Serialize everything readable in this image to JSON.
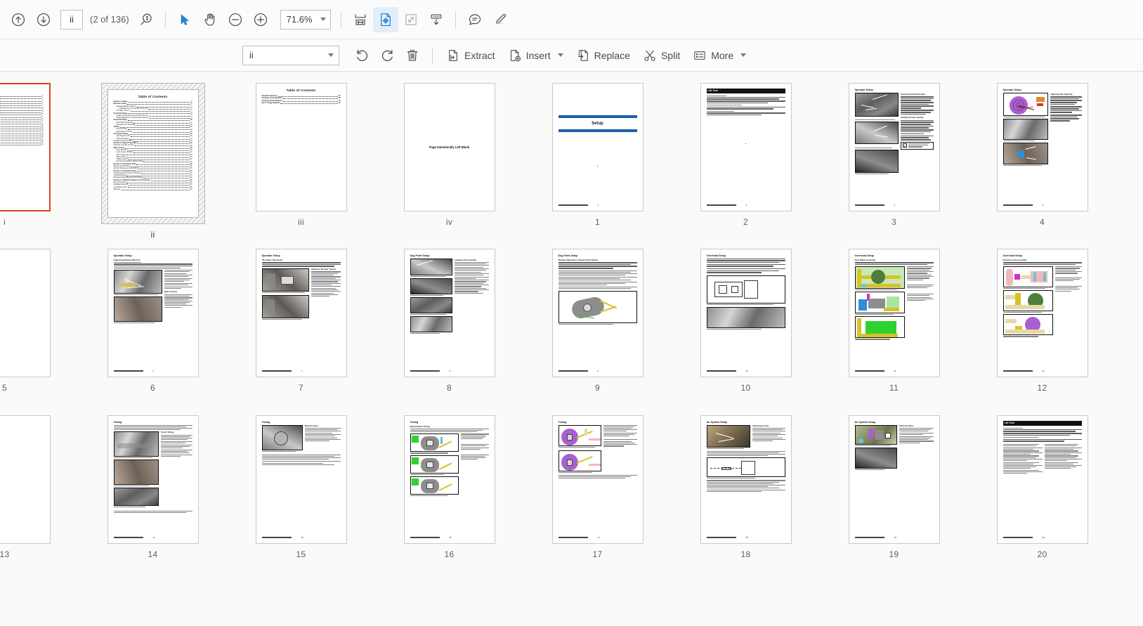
{
  "app": {
    "zoom_level": "71.6%",
    "accent_blue": "#1a7fd4",
    "selection_orange": "#d9441a"
  },
  "toolbar": {
    "page_field_value": "ii",
    "page_count_label": "(2 of 136)",
    "icons": [
      {
        "name": "previous-page-icon",
        "glyph": "arrow-up-circle"
      },
      {
        "name": "next-page-icon",
        "glyph": "arrow-down-circle"
      },
      {
        "name": "find-page-icon",
        "glyph": "magnifier-updown"
      },
      {
        "name": "select-tool-icon",
        "glyph": "cursor-arrow"
      },
      {
        "name": "hand-tool-icon",
        "glyph": "hand"
      },
      {
        "name": "zoom-out-icon",
        "glyph": "minus-circle"
      },
      {
        "name": "zoom-in-icon",
        "glyph": "plus-circle"
      },
      {
        "name": "fit-width-icon",
        "glyph": "fit-width"
      },
      {
        "name": "page-thumbnails-icon",
        "glyph": "page-move"
      },
      {
        "name": "fit-page-icon",
        "glyph": "fit-page"
      },
      {
        "name": "scroll-mode-icon",
        "glyph": "scroll-down"
      },
      {
        "name": "comment-icon",
        "glyph": "speech-bubble"
      },
      {
        "name": "highlight-icon",
        "glyph": "marker-pen"
      }
    ]
  },
  "page_toolbar": {
    "selection_value": "ii",
    "undo_label": "Undo",
    "redo_label": "Redo",
    "delete_label": "Delete",
    "buttons": [
      {
        "name": "extract-button",
        "label": "Extract",
        "icon": "extract-icon",
        "has_dropdown": false
      },
      {
        "name": "insert-button",
        "label": "Insert",
        "icon": "insert-icon",
        "has_dropdown": true
      },
      {
        "name": "replace-button",
        "label": "Replace",
        "icon": "replace-icon",
        "has_dropdown": false
      },
      {
        "name": "split-button",
        "label": "Split",
        "icon": "scissors-icon",
        "has_dropdown": false
      },
      {
        "name": "more-button",
        "label": "More",
        "icon": "list-icon",
        "has_dropdown": true
      }
    ]
  },
  "thumbnails": {
    "selected_page": "ii",
    "rows": [
      {
        "pages": [
          {
            "label": "i",
            "kind": "toc-long",
            "partial": true,
            "selected": false,
            "outlined": true
          },
          {
            "label": "ii",
            "kind": "toc-long",
            "partial": false,
            "selected": true,
            "outlined": false,
            "title": "Table of Contents"
          },
          {
            "label": "iii",
            "kind": "toc-short",
            "partial": false,
            "selected": false,
            "outlined": false,
            "title": "Table of Contents"
          },
          {
            "label": "iv",
            "kind": "blank-note",
            "partial": false,
            "selected": false,
            "outlined": false,
            "note": "Page Intentionally Left Blank"
          },
          {
            "label": "1",
            "kind": "divider",
            "partial": false,
            "selected": false,
            "outlined": false,
            "title": "Setup"
          },
          {
            "label": "2",
            "kind": "black-header",
            "partial": false,
            "selected": false,
            "outlined": false,
            "header": "Life Tech"
          },
          {
            "label": "3",
            "kind": "photo3",
            "partial": false,
            "selected": false,
            "outlined": false,
            "header": "Operator Setup"
          },
          {
            "label": "4",
            "kind": "photo-purple",
            "partial": false,
            "selected": false,
            "outlined": false,
            "header": "Operator Setup"
          }
        ]
      },
      {
        "pages": [
          {
            "label": "5",
            "kind": "blank-partial",
            "partial": true,
            "selected": false,
            "outlined": false
          },
          {
            "label": "6",
            "kind": "photo2",
            "partial": false,
            "selected": false,
            "outlined": false,
            "header": "Operator Setup",
            "subhead": "Adjusting Bottom Wrench"
          },
          {
            "label": "7",
            "kind": "photo2r",
            "partial": false,
            "selected": false,
            "outlined": false,
            "header": "Operator Setup",
            "subhead": "\"No Slap\" Set-Up #2"
          },
          {
            "label": "8",
            "kind": "photo4",
            "partial": false,
            "selected": false,
            "outlined": false,
            "header": "Dog Point Setup",
            "subhead": "Loading Unit Assembly"
          },
          {
            "label": "9",
            "kind": "diag-yellow",
            "partial": false,
            "selected": false,
            "outlined": false,
            "header": "Dog Point Setup",
            "subhead": "Setting Adjustment of Dual Cam Follower"
          },
          {
            "label": "10",
            "kind": "diag-box",
            "partial": false,
            "selected": false,
            "outlined": false,
            "header": "Overhead Setup"
          },
          {
            "label": "11",
            "kind": "diag-color3",
            "partial": false,
            "selected": false,
            "outlined": false,
            "header": "Overhead Setup",
            "subhead": "Face Blank Assembly"
          },
          {
            "label": "12",
            "kind": "diag-color3b",
            "partial": false,
            "selected": false,
            "outlined": false,
            "header": "Overhead Setup",
            "subhead": "Extrusion Arm Assembly"
          }
        ]
      },
      {
        "pages": [
          {
            "label": "13",
            "kind": "blank-partial",
            "partial": true,
            "selected": false,
            "outlined": false
          },
          {
            "label": "14",
            "kind": "photo3b",
            "partial": false,
            "selected": false,
            "outlined": false,
            "header": "Timing"
          },
          {
            "label": "15",
            "kind": "photo1",
            "partial": false,
            "selected": false,
            "outlined": false,
            "header": "Timing"
          },
          {
            "label": "16",
            "kind": "diag-timing",
            "partial": false,
            "selected": false,
            "outlined": false,
            "header": "Timing",
            "subhead": "Dial Indicator Timing"
          },
          {
            "label": "17",
            "kind": "diag-purple2",
            "partial": false,
            "selected": false,
            "outlined": false,
            "header": "Timing"
          },
          {
            "label": "18",
            "kind": "air-system",
            "partial": false,
            "selected": false,
            "outlined": false,
            "header": "Air System Setup",
            "subhead": "Adjusting Air Jets"
          },
          {
            "label": "19",
            "kind": "air-system2",
            "partial": false,
            "selected": false,
            "outlined": false,
            "header": "Air System Setup",
            "subhead": "Solenoid Valves"
          },
          {
            "label": "20",
            "kind": "checklist",
            "partial": false,
            "selected": false,
            "outlined": false,
            "header": "Life Tech"
          }
        ]
      }
    ]
  },
  "page_ii_toc": {
    "title": "Table of Contents",
    "entries": [
      {
        "text": "Section 1: Setup",
        "page": "1",
        "level": 0,
        "bold": true
      },
      {
        "text": "Operator Setup",
        "page": "3",
        "level": 0,
        "bold": true
      },
      {
        "text": "Adjusting Bottom Wrench",
        "page": "6",
        "level": 1,
        "bold": false
      },
      {
        "text": "Adjusting the Top Change of the Arm",
        "page": "6",
        "level": 2,
        "bold": false
      },
      {
        "text": "\"No Slap\" Set-Up",
        "page": "7",
        "level": 1,
        "bold": false
      },
      {
        "text": "Dog Point Setup",
        "page": "8",
        "level": 0,
        "bold": true
      },
      {
        "text": "Loading Unit Assembly for Dog Point Set",
        "page": "8",
        "level": 1,
        "bold": false
      },
      {
        "text": "Setting Adjustment of Dual Cam Follower",
        "page": "9",
        "level": 1,
        "bold": false
      },
      {
        "text": "Overhead Setup",
        "page": "10",
        "level": 0,
        "bold": true
      },
      {
        "text": "Face Blank Assembly",
        "page": "11",
        "level": 1,
        "bold": false
      },
      {
        "text": "Extrusion Arm Assembly",
        "page": "12",
        "level": 1,
        "bold": false
      },
      {
        "text": "Timing",
        "page": "14",
        "level": 0,
        "bold": true
      },
      {
        "text": "Punch Timing",
        "page": "14",
        "level": 1,
        "bold": false
      },
      {
        "text": "Dial Indicator Timing",
        "page": "16",
        "level": 1,
        "bold": false
      },
      {
        "text": "Air System Setup",
        "page": "18",
        "level": 0,
        "bold": true
      },
      {
        "text": "Adjusting Air Jets",
        "page": "18",
        "level": 1,
        "bold": false
      },
      {
        "text": "Solenoid Valves",
        "page": "19",
        "level": 1,
        "bold": false
      },
      {
        "text": "Changing Tools Sections",
        "page": "20",
        "level": 0,
        "bold": false
      },
      {
        "text": "Section 2: Support Operation",
        "page": "23",
        "level": 0,
        "bold": true
      },
      {
        "text": "Operator Controls & Panel",
        "page": "24",
        "level": 0,
        "bold": false
      },
      {
        "text": "Main Control",
        "page": "26",
        "level": 0,
        "bold": true
      },
      {
        "text": "Drive Motors",
        "page": "26",
        "level": 1,
        "bold": false
      },
      {
        "text": "Lube System Control",
        "page": "27",
        "level": 1,
        "bold": false
      },
      {
        "text": "Wire Feeder",
        "page": "28",
        "level": 1,
        "bold": false
      },
      {
        "text": "Safety Rules",
        "page": "30",
        "level": 1,
        "bold": false
      },
      {
        "text": "Tooling Section",
        "page": "32",
        "level": 1,
        "bold": false
      },
      {
        "text": "Performing Machine Safety Check",
        "page": "33",
        "level": 1,
        "bold": false
      },
      {
        "text": "Section 3: Production Data",
        "page": "35",
        "level": 0,
        "bold": true
      },
      {
        "text": "Sample Specifications",
        "page": "36",
        "level": 0,
        "bold": false
      },
      {
        "text": "Control Tolerances & Feed Roll",
        "page": "38",
        "level": 0,
        "bold": false
      },
      {
        "text": "Section 4: Troubleshooting",
        "page": "40",
        "level": 0,
        "bold": true
      },
      {
        "text": "Troubleshooting Common Problems",
        "page": "41",
        "level": 0,
        "bold": false
      },
      {
        "text": "Troubleshooting",
        "page": "43",
        "level": 0,
        "bold": false
      },
      {
        "text": "Troubleshooting Preventive Problems",
        "page": "46",
        "level": 0,
        "bold": false
      },
      {
        "text": "Section 5: Additional Support & Procedures",
        "page": "50",
        "level": 0,
        "bold": true
      },
      {
        "text": "Part Information",
        "page": "51",
        "level": 0,
        "bold": false
      },
      {
        "text": "Modified Drawings",
        "page": "53",
        "level": 0,
        "bold": false
      },
      {
        "text": "Lubrication Chart",
        "page": "55",
        "level": 0,
        "bold": false
      },
      {
        "text": "Warranty",
        "page": "56",
        "level": 0,
        "bold": false
      }
    ]
  },
  "page_iii_toc": {
    "title": "Table of Contents",
    "entries": [
      {
        "text": "Schedule Sections",
        "page": "57",
        "bold": true
      },
      {
        "text": "Tooling & Parts Manual 1",
        "page": "58",
        "bold": true
      },
      {
        "text": "Tooling & Parts Manual 2",
        "page": "70",
        "bold": true
      },
      {
        "text": "Part 1 Trigger Manual",
        "page": "79",
        "bold": true
      }
    ]
  },
  "page_footer_text": "Series Tec Corporation   (xx) 47-11098"
}
